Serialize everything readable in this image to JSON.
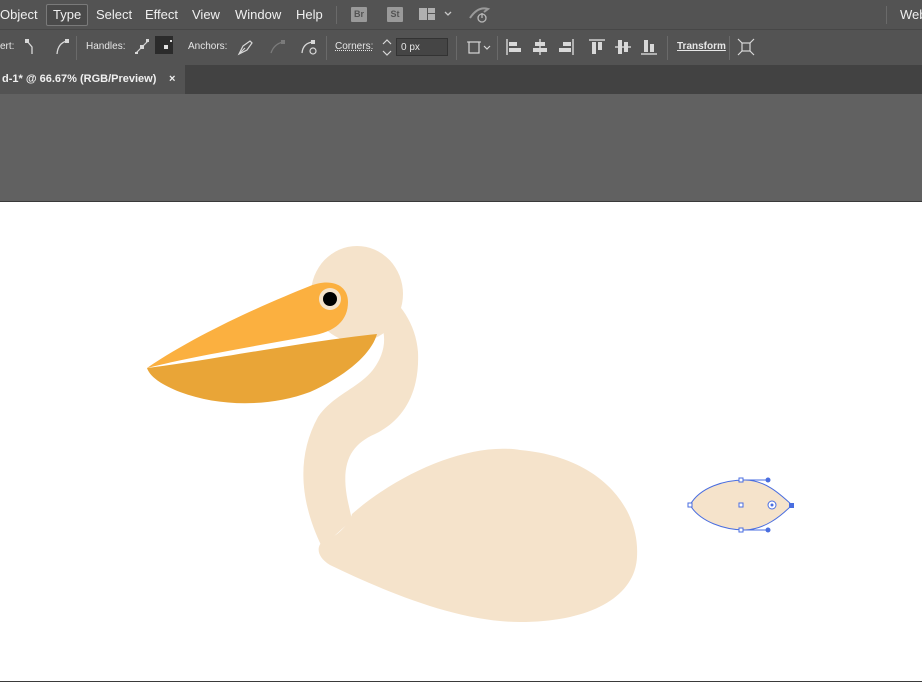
{
  "menubar": {
    "items": [
      {
        "label": "Object"
      },
      {
        "label": "Type",
        "active": true
      },
      {
        "label": "Select"
      },
      {
        "label": "Effect"
      },
      {
        "label": "View"
      },
      {
        "label": "Window"
      },
      {
        "label": "Help"
      }
    ],
    "bridge_label": "Br",
    "stock_label": "St",
    "layout_icon": "workspace-layout-icon",
    "gpu_icon": "gpu-performance-icon",
    "workspace_label": "Web"
  },
  "control_bar": {
    "convert_label": "ert:",
    "handles_label": "Handles:",
    "anchors_label": "Anchors:",
    "corners_label": "Corners:",
    "corners_value": "0 px",
    "transform_label": "Transform"
  },
  "document_tab": {
    "title": "d-1* @ 66.67% (RGB/Preview)",
    "close_label": "×"
  },
  "colors": {
    "ui_dark": "#535353",
    "pasteboard": "#616161",
    "pelican_body": "#f5e3cb",
    "beak_top": "#fbb040",
    "beak_bottom": "#e9a537",
    "selection_blue": "#4a6ee0"
  }
}
